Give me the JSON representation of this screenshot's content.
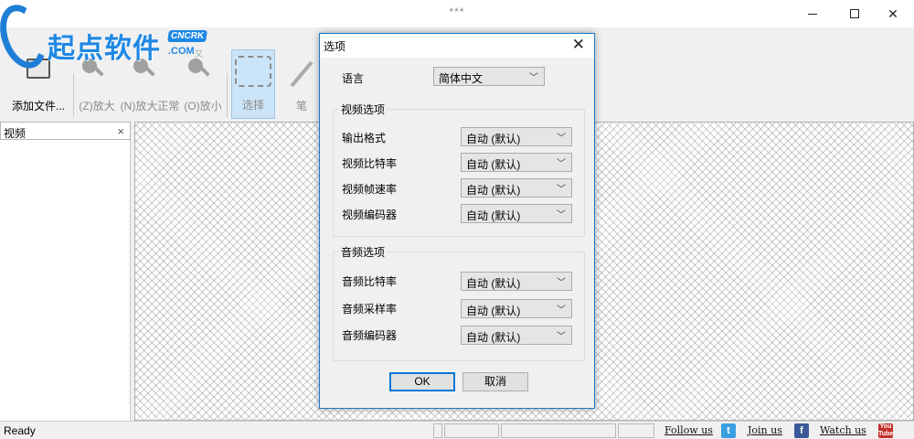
{
  "window": {
    "title": "***",
    "controls": {
      "minimize": "minimize",
      "maximize": "maximize",
      "close": "✕"
    }
  },
  "logo": {
    "text": "起点软件",
    "badge": "CNCRK",
    "sub": ".COM",
    "sub2": "又"
  },
  "toolbar": {
    "add_file": "添加文件...",
    "zoom_in": "(Z)放大",
    "zoom_normal": "(N)放大正常",
    "zoom_out": "(O)放小",
    "select": "选择",
    "pen": "笔"
  },
  "side_panel": {
    "title": "视频",
    "close": "×"
  },
  "status_bar": {
    "text": "Ready",
    "follow_us": "Follow us",
    "join_us": "Join us",
    "watch_us": "Watch us",
    "youtube_icon_text": "You Tube"
  },
  "dialog": {
    "title": "选项",
    "close": "✕",
    "language_label": "语言",
    "language_value": "简体中文",
    "video_group": {
      "title": "视频选项",
      "rows": [
        {
          "label": "输出格式",
          "value": "自动 (默认)"
        },
        {
          "label": "视频比特率",
          "value": "自动 (默认)"
        },
        {
          "label": "视频帧速率",
          "value": "自动 (默认)"
        },
        {
          "label": "视频编码器",
          "value": "自动 (默认)"
        }
      ]
    },
    "audio_group": {
      "title": "音频选项",
      "rows": [
        {
          "label": "音频比特率",
          "value": "自动 (默认)"
        },
        {
          "label": "音频采样率",
          "value": "自动 (默认)"
        },
        {
          "label": "音频编码器",
          "value": "自动 (默认)"
        }
      ]
    },
    "ok": "OK",
    "cancel": "取消"
  }
}
